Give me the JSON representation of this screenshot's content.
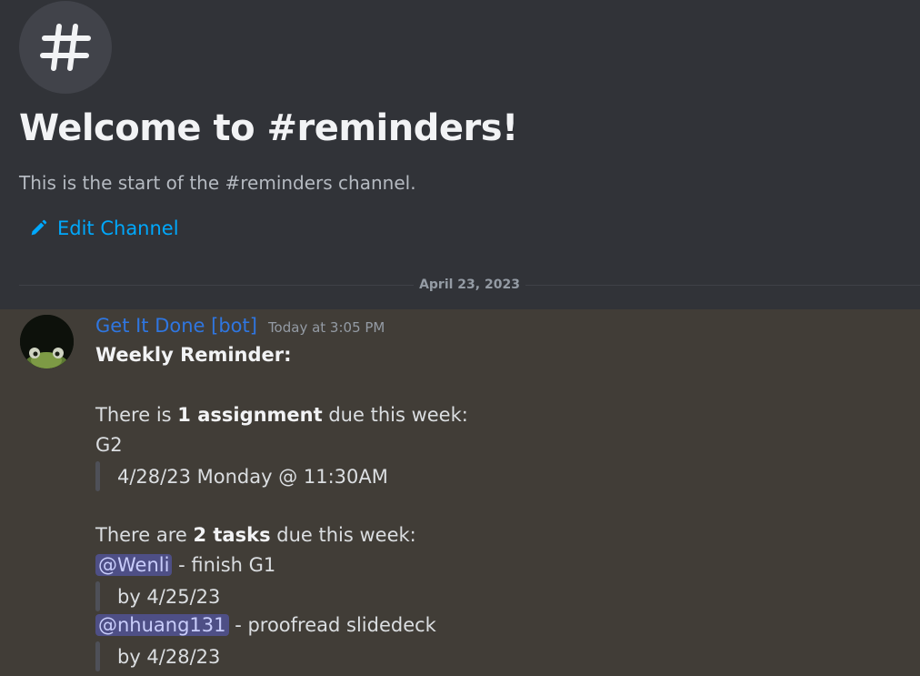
{
  "channel": {
    "icon": "hash-icon",
    "welcome_title": "Welcome to #reminders!",
    "welcome_subtitle": "This is the start of the #reminders channel.",
    "edit_channel_label": "Edit Channel",
    "edit_icon": "pencil-icon"
  },
  "divider": {
    "date": "April 23, 2023"
  },
  "message": {
    "author": "Get It Done [bot]",
    "timestamp": "Today at 3:05 PM",
    "heading": "Weekly Reminder:",
    "assign_prefix": "There is ",
    "assign_bold": "1 assignment",
    "assign_suffix": " due this week:",
    "assignment_name": "G2",
    "assignment_due": "4/28/23 Monday @ 11:30AM",
    "tasks_prefix": "There are ",
    "tasks_bold": "2 tasks",
    "tasks_suffix": " due this week:",
    "tasks": [
      {
        "mention": "@Wenli",
        "desc": " - finish G1",
        "due": "by 4/25/23"
      },
      {
        "mention": "@nhuang131",
        "desc": " - proofread slidedeck",
        "due": "by 4/28/23"
      }
    ]
  },
  "colors": {
    "background": "#313338",
    "message_highlight": "#413d37",
    "link": "#00a8fc",
    "bot_name": "#2f76e0",
    "mention_bg": "#4e4f86"
  }
}
